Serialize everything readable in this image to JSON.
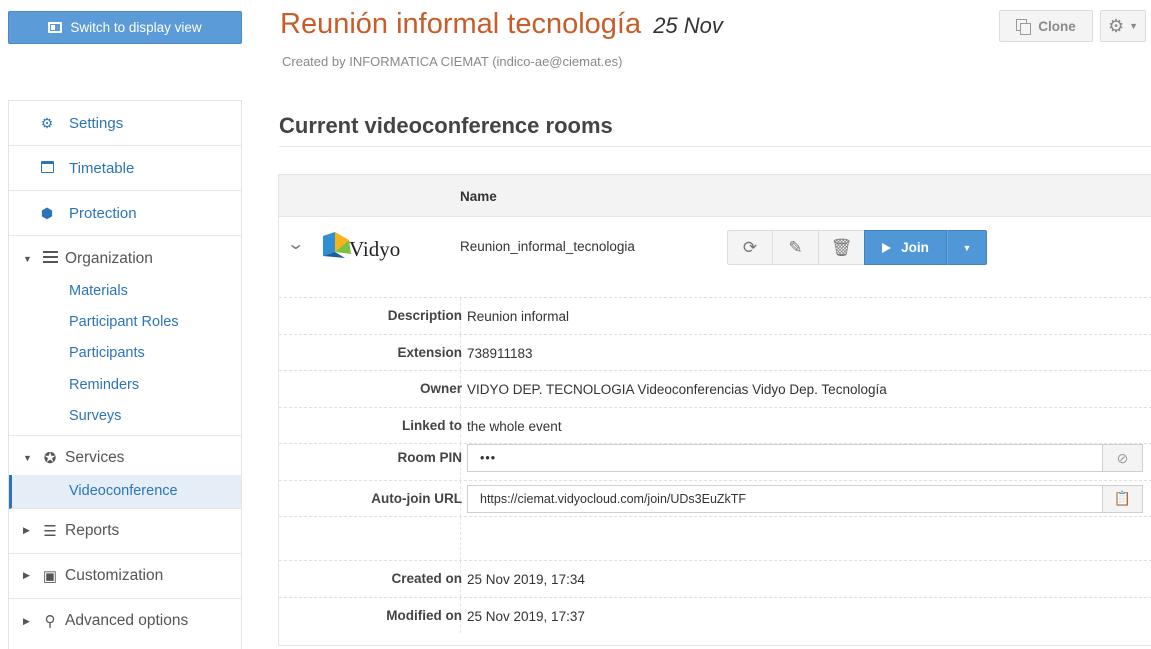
{
  "header": {
    "display_button_label": "Switch to display view",
    "title": "Reunión informal tecnología",
    "title_date": "25 Nov",
    "created_by": "Created by INFORMATICA CIEMAT (indico-ae@ciemat.es)",
    "clone_label": "Clone"
  },
  "sidebar": {
    "top_items": [
      {
        "label": "Settings",
        "icon": "gear-icon"
      },
      {
        "label": "Timetable",
        "icon": "calendar-icon"
      },
      {
        "label": "Protection",
        "icon": "shield-icon"
      }
    ],
    "organization": {
      "label": "Organization",
      "items": [
        "Materials",
        "Participant Roles",
        "Participants",
        "Reminders",
        "Surveys"
      ]
    },
    "services": {
      "label": "Services",
      "items": [
        "Videoconference"
      ]
    },
    "reports": {
      "label": "Reports"
    },
    "customization": {
      "label": "Customization"
    },
    "advanced": {
      "label": "Advanced options"
    }
  },
  "main": {
    "section_title": "Current videoconference rooms",
    "table_header_name": "Name",
    "room": {
      "provider": "Vidyo",
      "name": "Reunion_informal_tecnologia",
      "join_label": "Join"
    },
    "details": {
      "description_label": "Description",
      "description": "Reunion informal",
      "extension_label": "Extension",
      "extension": "738911183",
      "owner_label": "Owner",
      "owner": "VIDYO DEP. TECNOLOGIA Videoconferencias Vidyo Dep. Tecnología",
      "linked_label": "Linked to",
      "linked": "the whole event",
      "pin_label": "Room PIN",
      "pin": "•••",
      "autojoin_label": "Auto-join URL",
      "autojoin": "https://ciemat.vidyocloud.com/join/UDs3EuZkTF",
      "created_label": "Created on",
      "created": "25 Nov 2019, 17:34",
      "modified_label": "Modified on",
      "modified": "25 Nov 2019, 17:37"
    }
  },
  "colors": {
    "title": "#c95c28",
    "link": "#2c74b9",
    "primary_button": "#4f97d6"
  }
}
